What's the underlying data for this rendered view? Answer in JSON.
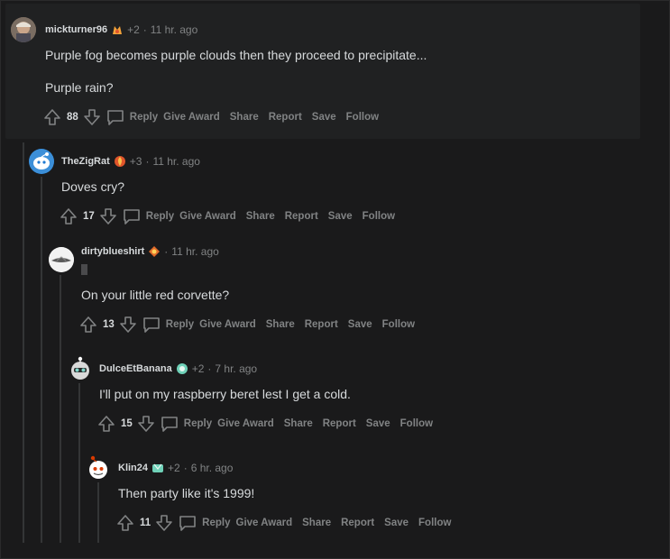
{
  "comments": [
    {
      "author": "mickturner96",
      "awards": "+2",
      "time": "11 hr. ago",
      "lines": [
        "Purple fog becomes purple clouds then they proceed to precipitate...",
        "Purple rain?"
      ],
      "score": "88"
    },
    {
      "author": "TheZigRat",
      "awards": "+3",
      "time": "11 hr. ago",
      "lines": [
        "Doves cry?"
      ],
      "score": "17"
    },
    {
      "author": "dirtyblueshirt",
      "awards": "",
      "time": "11 hr. ago",
      "lines": [
        "On your little red corvette?"
      ],
      "score": "13"
    },
    {
      "author": "DulceEtBanana",
      "awards": "+2",
      "time": "7 hr. ago",
      "lines": [
        "I'll put on my raspberry beret lest I get a cold."
      ],
      "score": "15"
    },
    {
      "author": "Klin24",
      "awards": "+2",
      "time": "6 hr. ago",
      "lines": [
        "Then party like it's 1999!"
      ],
      "score": "11"
    }
  ],
  "actions": {
    "reply": "Reply",
    "give_award": "Give Award",
    "share": "Share",
    "report": "Report",
    "save": "Save",
    "follow": "Follow"
  },
  "separator": "·",
  "colors": {
    "background": "#1a1a1b",
    "panel": "#202122",
    "text": "#d7dadc",
    "muted": "#818384",
    "thread_line": "#343536"
  },
  "icons": [
    "upvote-icon",
    "downvote-icon",
    "comment-bubble-icon",
    "award-flair-icon",
    "avatar"
  ]
}
